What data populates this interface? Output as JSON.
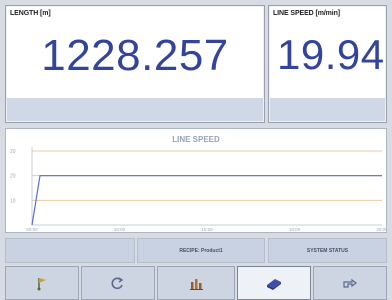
{
  "length_panel": {
    "title": "LENGTH [m]",
    "value": "1228.257"
  },
  "speed_panel": {
    "title": "LINE SPEED [m/min]",
    "value": "19.94"
  },
  "chart_data": {
    "type": "line",
    "title": "LINE SPEED",
    "y_ticks": [
      "20",
      "20",
      "10"
    ],
    "x_ticks": [
      "00:00",
      "10:00",
      "15:00",
      "18:00",
      "20:00"
    ],
    "series": [
      {
        "x": [
          0,
          0.1,
          1
        ],
        "y": [
          0,
          20,
          20
        ]
      }
    ],
    "ylim": [
      0,
      30
    ],
    "grid": true
  },
  "status_bar": {
    "recipe": "RECIPE: Product1",
    "system_status": "SYSTEM STATUS"
  },
  "toolbar": {
    "buttons": [
      {
        "icon": "pin-flag-icon",
        "active": false
      },
      {
        "icon": "refresh-icon",
        "active": false
      },
      {
        "icon": "bar-chart-icon",
        "active": false
      },
      {
        "icon": "device-icon",
        "active": true
      },
      {
        "icon": "pointing-hand-icon",
        "active": false
      }
    ]
  },
  "colors": {
    "value_blue": "#33449a",
    "line_blue": "#5a6fc6",
    "grid_orange": "#e8c9a2",
    "background": "#d6dbe4"
  }
}
